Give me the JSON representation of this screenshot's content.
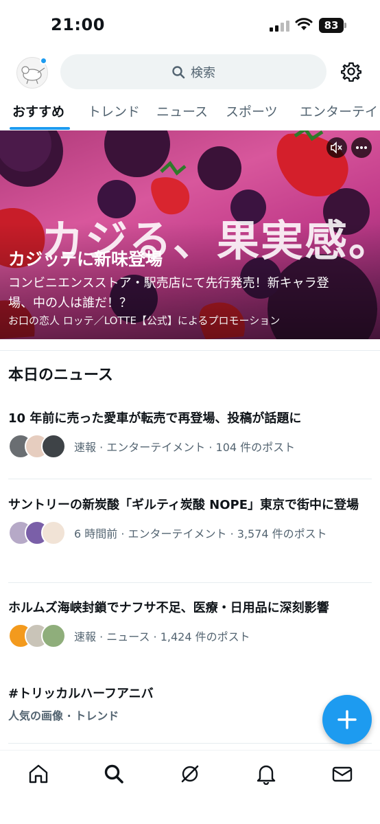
{
  "status_bar": {
    "time": "21:00",
    "battery": "83"
  },
  "header": {
    "search_placeholder": "検索"
  },
  "tabs": [
    {
      "label": "おすすめ",
      "active": true
    },
    {
      "label": "トレンド"
    },
    {
      "label": "ニュース"
    },
    {
      "label": "スポーツ"
    },
    {
      "label": "エンターテイ"
    }
  ],
  "promo": {
    "image_text": "カジる、果実感。",
    "title": "カジッテに新味登場",
    "description": "コンビニエンスストア・駅売店にて先行発売！新キャラ登場、中の人は誰だ！？",
    "sponsor": "お口の恋人 ロッテ／LOTTE【公式】によるプロモーション"
  },
  "news": {
    "heading": "本日のニュース",
    "items": [
      {
        "title": "10 年前に売った愛車が転売で再登場、投稿が話題に",
        "meta": "速報 · エンターテイメント · 104 件のポスト"
      },
      {
        "title": "サントリーの新炭酸「ギルティ炭酸 NOPE」東京で街中に登場",
        "meta": "6 時間前 · エンターテイメント · 3,574 件のポスト"
      },
      {
        "title": "ホルムズ海峡封鎖でナフサ不足、医療・日用品に深刻影響",
        "meta": "速報 · ニュース · 1,424 件のポスト"
      }
    ],
    "trend": {
      "title": "#トリッカルハーフアニバ",
      "meta": "人気の画像 · トレンド"
    }
  },
  "colors": {
    "accent": "#1d9bf0",
    "text_primary": "#0f1419",
    "text_secondary": "#536471"
  },
  "icons": {
    "header": [
      "profile-avatar",
      "search-icon",
      "gear-icon"
    ],
    "promo": [
      "mute-icon",
      "more-icon"
    ],
    "bottom_nav": [
      "home-icon",
      "search-icon",
      "grok-icon",
      "bell-icon",
      "mail-icon"
    ],
    "fab": "plus-icon"
  }
}
